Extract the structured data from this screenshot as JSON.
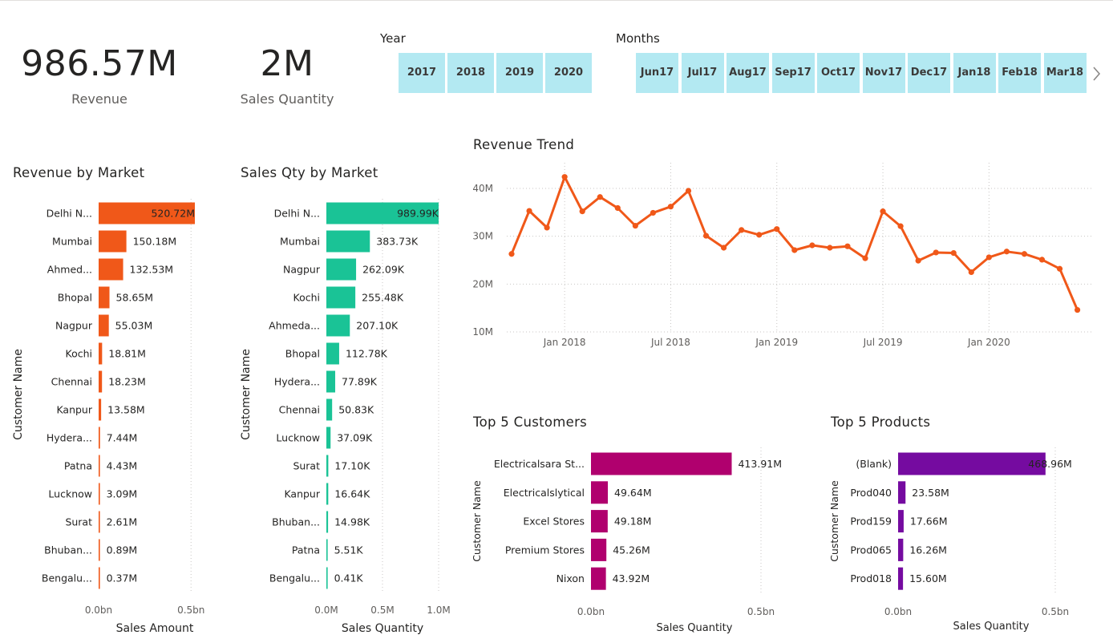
{
  "kpis": {
    "revenue": {
      "value": "986.57M",
      "label": "Revenue"
    },
    "quantity": {
      "value": "2M",
      "label": "Sales Quantity"
    }
  },
  "year_slicer": {
    "title": "Year",
    "options": [
      "2017",
      "2018",
      "2019",
      "2020"
    ]
  },
  "month_slicer": {
    "title": "Months",
    "options": [
      [
        "Jun",
        "17"
      ],
      [
        "Jul",
        "17"
      ],
      [
        "Aug",
        "17"
      ],
      [
        "Sep",
        "17"
      ],
      [
        "Oct",
        "17"
      ],
      [
        "Nov",
        "17"
      ],
      [
        "Dec",
        "17"
      ],
      [
        "Jan",
        "18"
      ],
      [
        "Feb",
        "18"
      ],
      [
        "Mar",
        "18"
      ]
    ],
    "next_icon": "chevron-right-icon"
  },
  "charts": {
    "revenue_by_market": {
      "title": "Revenue by Market",
      "ylabel": "Customer Name",
      "xlabel": "Sales Amount",
      "color": "#f05819",
      "ticks": [
        "0.0bn",
        "0.5bn"
      ],
      "categories": [
        "Delhi N...",
        "Mumbai",
        "Ahmed...",
        "Bhopal",
        "Nagpur",
        "Kochi",
        "Chennai",
        "Kanpur",
        "Hydera...",
        "Patna",
        "Lucknow",
        "Surat",
        "Bhuban...",
        "Bengalu..."
      ],
      "labels": [
        "520.72M",
        "150.18M",
        "132.53M",
        "58.65M",
        "55.03M",
        "18.81M",
        "18.23M",
        "13.58M",
        "7.44M",
        "4.43M",
        "3.09M",
        "2.61M",
        "0.89M",
        "0.37M"
      ]
    },
    "sales_qty_by_market": {
      "title": "Sales Qty by Market",
      "ylabel": "Customer Name",
      "xlabel": "Sales Quantity",
      "color": "#1ac396",
      "ticks": [
        "0.0M",
        "0.5M",
        "1.0M"
      ],
      "categories": [
        "Delhi N...",
        "Mumbai",
        "Nagpur",
        "Kochi",
        "Ahmeda...",
        "Bhopal",
        "Hydera...",
        "Chennai",
        "Lucknow",
        "Surat",
        "Kanpur",
        "Bhuban...",
        "Patna",
        "Bengalu..."
      ],
      "labels": [
        "989.99K",
        "383.73K",
        "262.09K",
        "255.48K",
        "207.10K",
        "112.78K",
        "77.89K",
        "50.83K",
        "37.09K",
        "17.10K",
        "16.64K",
        "14.98K",
        "5.51K",
        "0.41K"
      ]
    },
    "revenue_trend": {
      "title": "Revenue Trend",
      "color": "#f05819",
      "yticks": [
        "40M",
        "30M",
        "20M",
        "10M"
      ],
      "xticks": [
        "Jan 2018",
        "Jul 2018",
        "Jan 2019",
        "Jul 2019",
        "Jan 2020"
      ]
    },
    "top_customers": {
      "title": "Top 5 Customers",
      "ylabel": "Customer Name",
      "xlabel": "Sales Quantity",
      "color": "#b0006e",
      "ticks": [
        "0.0bn",
        "0.5bn"
      ],
      "categories": [
        "Electricalsara St...",
        "Electricalslytical",
        "Excel Stores",
        "Premium Stores",
        "Nixon"
      ],
      "labels": [
        "413.91M",
        "49.64M",
        "49.18M",
        "45.26M",
        "43.92M"
      ]
    },
    "top_products": {
      "title": "Top 5 Products",
      "ylabel": "Customer Name",
      "xlabel": "Sales Quantity",
      "color": "#750ba0",
      "ticks": [
        "0.0bn",
        "0.5bn"
      ],
      "categories": [
        "(Blank)",
        "Prod040",
        "Prod159",
        "Prod065",
        "Prod018"
      ],
      "labels": [
        "468.96M",
        "23.58M",
        "17.66M",
        "16.26M",
        "15.60M"
      ]
    }
  },
  "chart_data": [
    {
      "type": "bar",
      "title": "Revenue by Market",
      "xlabel": "Sales Amount",
      "ylabel": "Customer Name",
      "categories": [
        "Delhi N...",
        "Mumbai",
        "Ahmed...",
        "Bhopal",
        "Nagpur",
        "Kochi",
        "Chennai",
        "Kanpur",
        "Hydera...",
        "Patna",
        "Lucknow",
        "Surat",
        "Bhuban...",
        "Bengalu..."
      ],
      "values": [
        520.72,
        150.18,
        132.53,
        58.65,
        55.03,
        18.81,
        18.23,
        13.58,
        7.44,
        4.43,
        3.09,
        2.61,
        0.89,
        0.37
      ],
      "xlim": [
        0,
        520.72
      ]
    },
    {
      "type": "bar",
      "title": "Sales Qty by Market",
      "xlabel": "Sales Quantity",
      "ylabel": "Customer Name",
      "categories": [
        "Delhi N...",
        "Mumbai",
        "Nagpur",
        "Kochi",
        "Ahmeda...",
        "Bhopal",
        "Hydera...",
        "Chennai",
        "Lucknow",
        "Surat",
        "Kanpur",
        "Bhuban...",
        "Patna",
        "Bengalu..."
      ],
      "values": [
        989.99,
        383.73,
        262.09,
        255.48,
        207.1,
        112.78,
        77.89,
        50.83,
        37.09,
        17.1,
        16.64,
        14.98,
        5.51,
        0.41
      ],
      "xlim": [
        0,
        989.99
      ]
    },
    {
      "type": "line",
      "title": "Revenue Trend",
      "x": [
        "2017-10",
        "2017-11",
        "2017-12",
        "2018-01",
        "2018-02",
        "2018-03",
        "2018-04",
        "2018-05",
        "2018-06",
        "2018-07",
        "2018-08",
        "2018-09",
        "2018-10",
        "2018-11",
        "2018-12",
        "2019-01",
        "2019-02",
        "2019-03",
        "2019-04",
        "2019-05",
        "2019-06",
        "2019-07",
        "2019-08",
        "2019-09",
        "2019-10",
        "2019-11",
        "2019-12",
        "2020-01",
        "2020-02",
        "2020-03",
        "2020-04",
        "2020-05",
        "2020-06"
      ],
      "values": [
        26.3,
        35.3,
        31.8,
        42.4,
        35.2,
        38.2,
        35.9,
        32.2,
        34.9,
        36.2,
        39.5,
        30.1,
        27.6,
        31.3,
        30.3,
        31.5,
        27.1,
        28.1,
        27.6,
        27.9,
        25.4,
        35.2,
        32.1,
        24.9,
        26.6,
        26.5,
        22.5,
        25.6,
        26.8,
        26.3,
        25.1,
        23.2,
        14.6
      ],
      "ylim": [
        10,
        40
      ]
    },
    {
      "type": "bar",
      "title": "Top 5 Customers",
      "xlabel": "Sales Quantity",
      "ylabel": "Customer Name",
      "categories": [
        "Electricalsara St...",
        "Electricalslytical",
        "Excel Stores",
        "Premium Stores",
        "Nixon"
      ],
      "values": [
        413.91,
        49.64,
        49.18,
        45.26,
        43.92
      ],
      "xlim": [
        0,
        500
      ]
    },
    {
      "type": "bar",
      "title": "Top 5 Products",
      "xlabel": "Sales Quantity",
      "ylabel": "Customer Name",
      "categories": [
        "(Blank)",
        "Prod040",
        "Prod159",
        "Prod065",
        "Prod018"
      ],
      "values": [
        468.96,
        23.58,
        17.66,
        16.26,
        15.6
      ],
      "xlim": [
        0,
        500
      ]
    }
  ]
}
